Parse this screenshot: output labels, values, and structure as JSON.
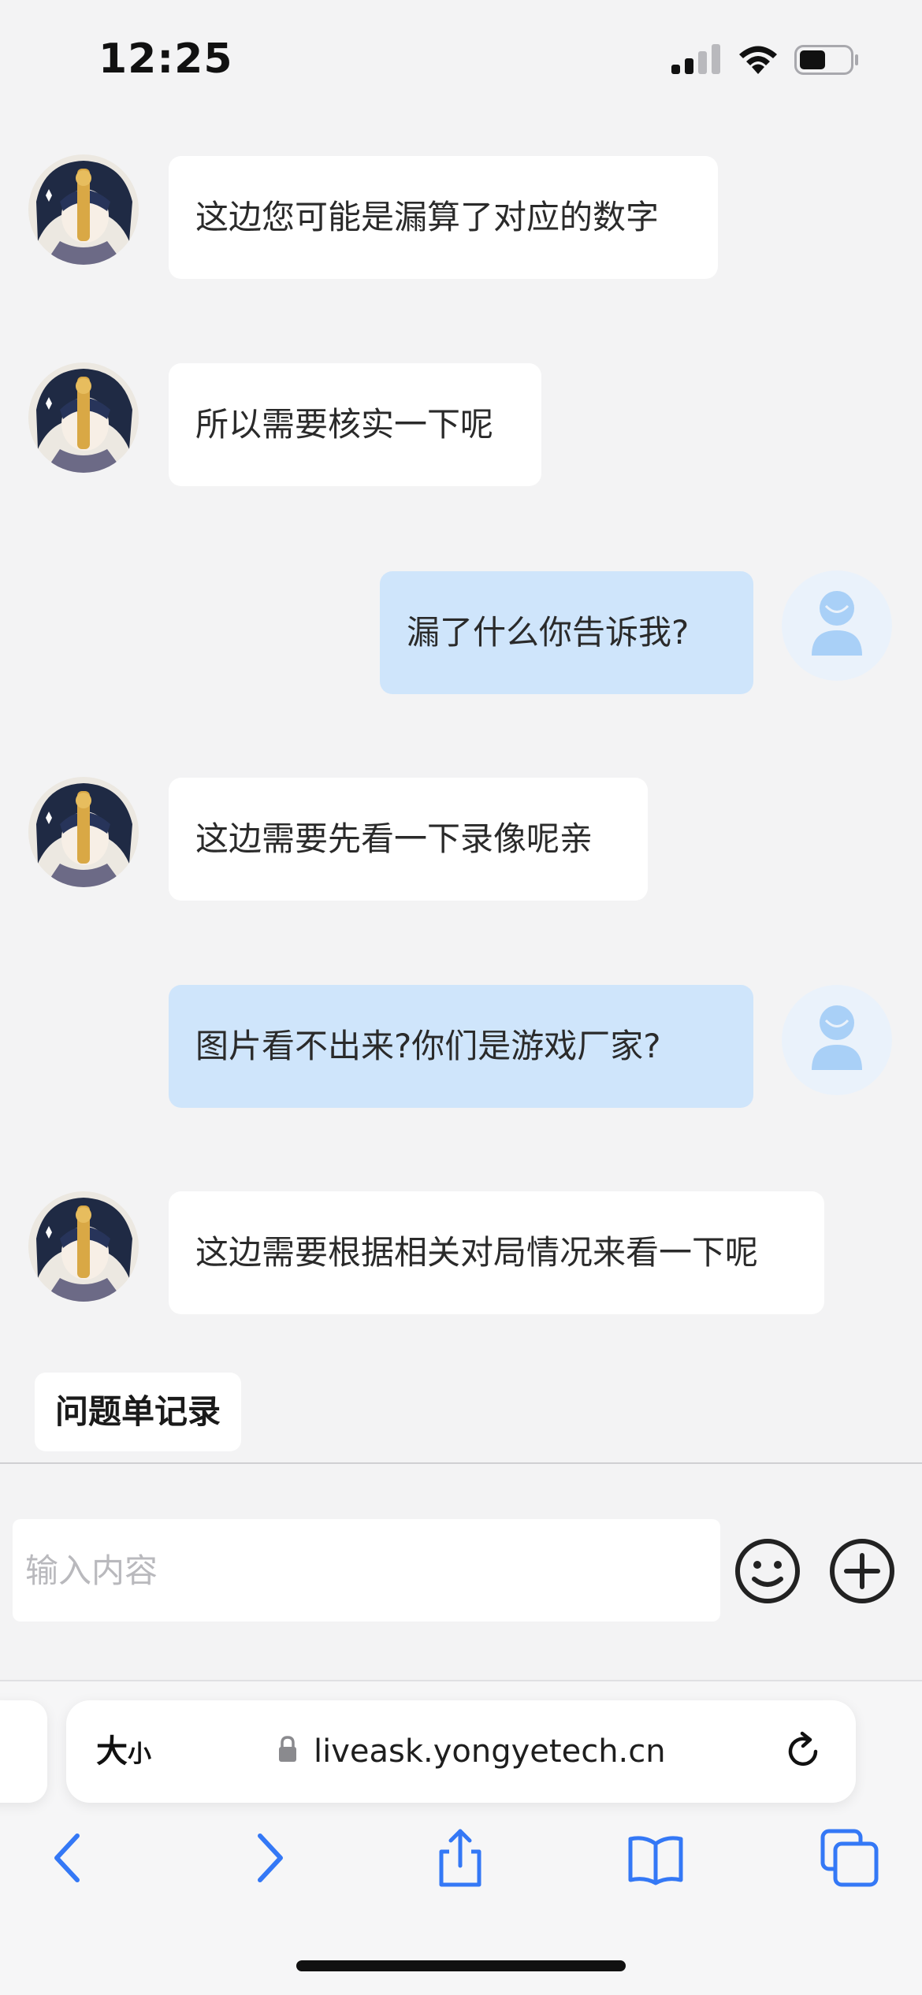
{
  "status_bar": {
    "time": "12:25"
  },
  "messages": [
    {
      "side": "agent",
      "text": "这边您可能是漏算了对应的数字"
    },
    {
      "side": "agent",
      "text": "所以需要核实一下呢"
    },
    {
      "side": "user",
      "text": "漏了什么你告诉我?"
    },
    {
      "side": "agent",
      "text": "这边需要先看一下录像呢亲"
    },
    {
      "side": "user",
      "text": "图片看不出来?你们是游戏厂家?"
    },
    {
      "side": "agent",
      "text": "这边需要根据相关对局情况来看一下呢"
    }
  ],
  "quick_tag": {
    "label": "问题单记录"
  },
  "input": {
    "placeholder": "输入内容"
  },
  "safari": {
    "text_size_big": "大",
    "text_size_small": "小",
    "url": "liveask.yongyetech.cn"
  },
  "colors": {
    "user_bubble": "#cfe5fb",
    "agent_bubble": "#ffffff",
    "accent": "#3478f6"
  },
  "icons": [
    "signal-icon",
    "wifi-icon",
    "battery-icon",
    "emoji-icon",
    "plus-circle-icon",
    "lock-icon",
    "reload-icon",
    "back-icon",
    "forward-icon",
    "share-icon",
    "bookmarks-icon",
    "tabs-icon"
  ]
}
